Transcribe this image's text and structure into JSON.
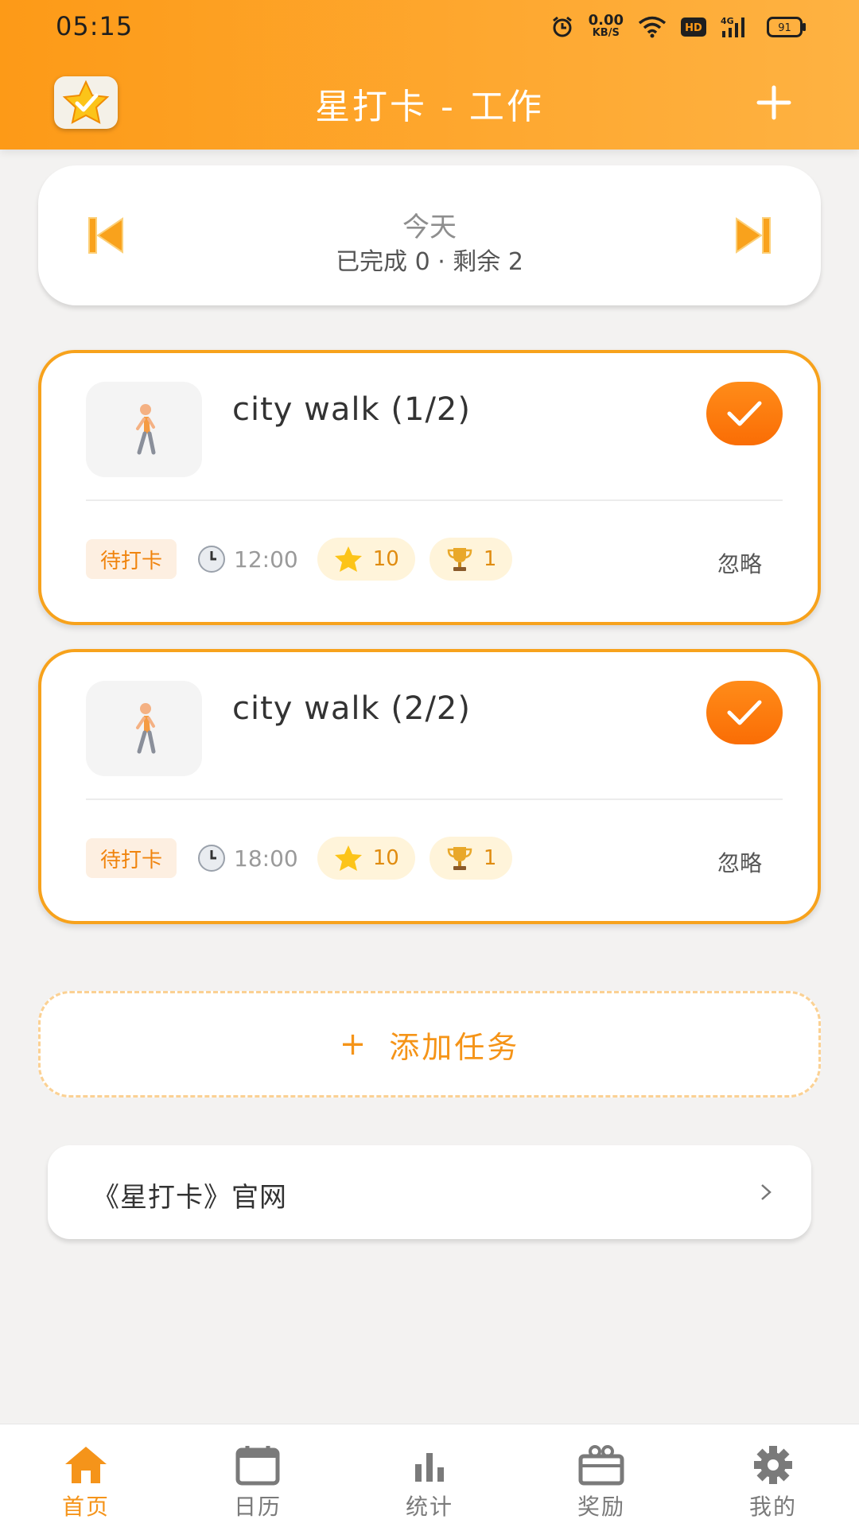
{
  "status_bar": {
    "time": "05:15",
    "net_speed_value": "0.00",
    "net_speed_unit": "KB/S",
    "hd_badge": "HD",
    "network_type": "4G",
    "battery_level": "91",
    "icons": [
      "alarm-icon",
      "wifi-icon",
      "hd-icon",
      "signal-icon",
      "battery-icon"
    ]
  },
  "header": {
    "title": "星打卡 - 工作",
    "logo_icon": "star-check-icon",
    "add_icon": "plus-icon"
  },
  "date_nav": {
    "label": "今天",
    "summary": "已完成 0 · 剩余 2",
    "prev_icon": "skip-previous-icon",
    "next_icon": "skip-next-icon"
  },
  "tasks": [
    {
      "title": "city walk (1/2)",
      "icon": "person-walking-icon",
      "status": "待打卡",
      "time": "12:00",
      "stars": "10",
      "trophies": "1",
      "ignore_label": "忽略"
    },
    {
      "title": "city walk (2/2)",
      "icon": "person-walking-icon",
      "status": "待打卡",
      "time": "18:00",
      "stars": "10",
      "trophies": "1",
      "ignore_label": "忽略"
    }
  ],
  "add_task": {
    "plus": "+",
    "label": "添加任务"
  },
  "website_link": {
    "label": "《星打卡》官网",
    "chevron": ">"
  },
  "bottom_nav": [
    {
      "label": "首页",
      "icon": "home-icon",
      "active": true
    },
    {
      "label": "日历",
      "icon": "calendar-icon",
      "active": false
    },
    {
      "label": "统计",
      "icon": "bar-chart-icon",
      "active": false
    },
    {
      "label": "奖励",
      "icon": "gift-box-icon",
      "active": false
    },
    {
      "label": "我的",
      "icon": "gear-icon",
      "active": false
    }
  ],
  "colors": {
    "brand_orange": "#fd9a17",
    "accent_orange": "#f7a21c",
    "check_orange": "#fa6d05",
    "background": "#f3f2f1"
  }
}
